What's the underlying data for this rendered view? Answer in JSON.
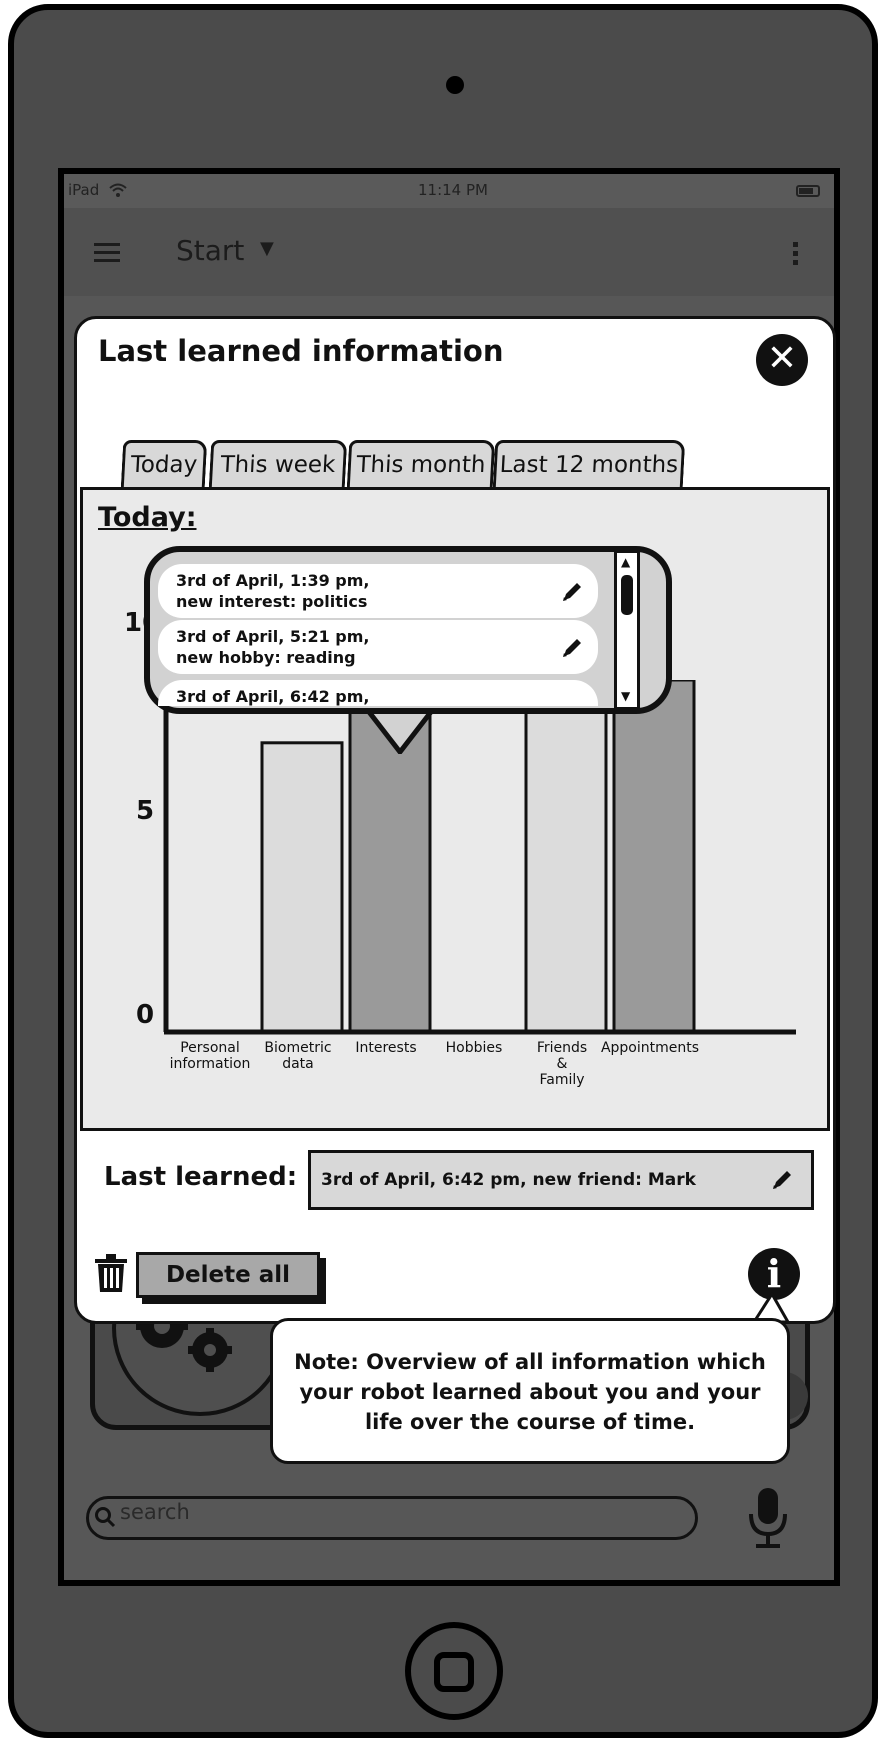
{
  "status_bar": {
    "device": "iPad",
    "time": "11:14 PM"
  },
  "nav_bar": {
    "title": "Start"
  },
  "modal": {
    "title": "Last learned information",
    "close_icon": "close-icon",
    "tabs": [
      "Today",
      "This week",
      "This month",
      "Last 12 months"
    ],
    "active_tab": "Today",
    "panel_title": "Today:",
    "popover_items": [
      {
        "line1": "3rd of April, 1:39 pm,",
        "line2": "new interest: politics"
      },
      {
        "line1": "3rd of April, 5:21 pm,",
        "line2": "new hobby: reading"
      },
      {
        "line1": "3rd of April, 6:42 pm,",
        "line2": ""
      }
    ],
    "last_learned_label": "Last learned:",
    "last_learned_value": "3rd of April, 6:42 pm, new friend: Mark",
    "delete_all_label": "Delete all"
  },
  "chart_data": {
    "type": "bar",
    "categories": [
      "Personal information",
      "Biometric data",
      "Interests",
      "Hobbies",
      "Friends & Family",
      "Appointments"
    ],
    "category_labels": [
      [
        "Personal",
        "information"
      ],
      [
        "Biometric",
        "data"
      ],
      [
        "Interests"
      ],
      [
        "Hobbies"
      ],
      [
        "Friends",
        "&",
        "Family"
      ],
      [
        "Appointments"
      ]
    ],
    "values": [
      0,
      6,
      7,
      0,
      8,
      8
    ],
    "yticks": [
      "0",
      "5",
      "10"
    ],
    "ylim": [
      0,
      10
    ],
    "highlighted_category": "Interests",
    "colors": {
      "bar_light": "#dcdcdc",
      "bar_dark": "#9a9a9a"
    }
  },
  "note": {
    "lines": [
      "Note: Overview of all information which",
      "your robot learned about you and your",
      "life over the course of time."
    ]
  },
  "search": {
    "placeholder": "search"
  },
  "icons": {
    "menu": "hamburger-icon",
    "dropdown": "chevron-down-icon",
    "more": "more-vertical-icon",
    "edit": "pencil-icon",
    "delete": "trash-icon",
    "info": "info-icon",
    "search": "search-icon",
    "mic": "microphone-icon"
  }
}
